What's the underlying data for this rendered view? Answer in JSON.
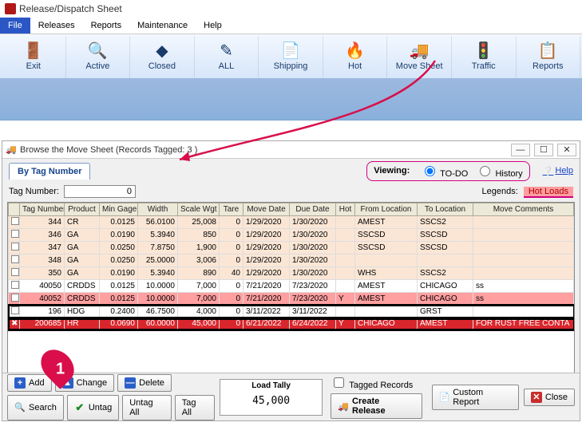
{
  "app": {
    "title": "Release/Dispatch Sheet"
  },
  "menubar": [
    "File",
    "Releases",
    "Reports",
    "Maintenance",
    "Help"
  ],
  "toolbar": [
    {
      "label": "Exit",
      "icon": "🚪"
    },
    {
      "label": "Active",
      "icon": "🔍"
    },
    {
      "label": "Closed",
      "icon": "◆"
    },
    {
      "label": "ALL",
      "icon": "✎"
    },
    {
      "label": "Shipping",
      "icon": "📄"
    },
    {
      "label": "Hot",
      "icon": "🔥"
    },
    {
      "label": "Move Sheet",
      "icon": "🚚"
    },
    {
      "label": "Traffic",
      "icon": "🚦"
    },
    {
      "label": "Reports",
      "icon": "📋"
    }
  ],
  "child": {
    "title": "Browse the Move Sheet  (Records Tagged:  3 )",
    "tab": "By Tag Number",
    "viewing_label": "Viewing:",
    "viewing_opts": [
      "TO-DO",
      "History"
    ],
    "help": "Help",
    "tagnum_label": "Tag Number:",
    "tagnum_value": "0",
    "legends_label": "Legends:",
    "legends_hot": "Hot Loads"
  },
  "grid": {
    "headers": [
      "",
      "Tag Number",
      "Product",
      "Min Gage",
      "Width",
      "Scale Wgt",
      "Tare",
      "Move Date",
      "Due Date",
      "Hot",
      "From Location",
      "To Location",
      "Move Comments"
    ],
    "rows": [
      {
        "ck": "",
        "tag": "344",
        "prod": "CR",
        "gage": "0.0125",
        "width": "56.0100",
        "wgt": "25,008",
        "tare": "0",
        "md": "1/29/2020",
        "dd": "1/30/2020",
        "hot": "",
        "from": "AMEST",
        "to": "SSCS2",
        "cm": "",
        "cls": ""
      },
      {
        "ck": "",
        "tag": "346",
        "prod": "GA",
        "gage": "0.0190",
        "width": "5.3940",
        "wgt": "850",
        "tare": "0",
        "md": "1/29/2020",
        "dd": "1/30/2020",
        "hot": "",
        "from": "SSCSD",
        "to": "SSCSD",
        "cm": "",
        "cls": ""
      },
      {
        "ck": "",
        "tag": "347",
        "prod": "GA",
        "gage": "0.0250",
        "width": "7.8750",
        "wgt": "1,900",
        "tare": "0",
        "md": "1/29/2020",
        "dd": "1/30/2020",
        "hot": "",
        "from": "SSCSD",
        "to": "SSCSD",
        "cm": "",
        "cls": ""
      },
      {
        "ck": "",
        "tag": "348",
        "prod": "GA",
        "gage": "0.0250",
        "width": "25.0000",
        "wgt": "3,006",
        "tare": "0",
        "md": "1/29/2020",
        "dd": "1/30/2020",
        "hot": "",
        "from": "",
        "to": "",
        "cm": "",
        "cls": ""
      },
      {
        "ck": "",
        "tag": "350",
        "prod": "GA",
        "gage": "0.0190",
        "width": "5.3940",
        "wgt": "890",
        "tare": "40",
        "md": "1/29/2020",
        "dd": "1/30/2020",
        "hot": "",
        "from": "WHS",
        "to": "SSCS2",
        "cm": "",
        "cls": ""
      },
      {
        "ck": "",
        "tag": "40050",
        "prod": "CRDDS",
        "gage": "0.0125",
        "width": "10.0000",
        "wgt": "7,000",
        "tare": "0",
        "md": "7/21/2020",
        "dd": "7/23/2020",
        "hot": "",
        "from": "AMEST",
        "to": "CHICAGO",
        "cm": "ss",
        "cls": "plain"
      },
      {
        "ck": "",
        "tag": "40052",
        "prod": "CRDDS",
        "gage": "0.0125",
        "width": "10.0000",
        "wgt": "7,000",
        "tare": "0",
        "md": "7/21/2020",
        "dd": "7/23/2020",
        "hot": "Y",
        "from": "AMEST",
        "to": "CHICAGO",
        "cm": "ss",
        "cls": "hot"
      },
      {
        "ck": "",
        "tag": "196",
        "prod": "HDG",
        "gage": "0.2400",
        "width": "46.7500",
        "wgt": "4,000",
        "tare": "0",
        "md": "3/11/2022",
        "dd": "3/11/2022",
        "hot": "",
        "from": "",
        "to": "GRST",
        "cm": "",
        "cls": "plain boxed"
      },
      {
        "ck": "✖",
        "tag": "200685",
        "prod": "HR",
        "gage": "0.0690",
        "width": "60.0000",
        "wgt": "45,000",
        "tare": "0",
        "md": "6/21/2022",
        "dd": "6/24/2022",
        "hot": "Y",
        "from": "CHICAGO",
        "to": "AMEST",
        "cm": "FOR RUST FREE CONTA",
        "cls": "sel boxed"
      }
    ]
  },
  "tally": {
    "label": "Load Tally",
    "value": "45,000"
  },
  "buttons": {
    "add": "Add",
    "change": "Change",
    "delete": "Delete",
    "search": "Search",
    "untag": "Untag",
    "untag_all": "Untag All",
    "tag_all": "Tag All",
    "tagged_records": "Tagged Records",
    "create_release": "Create Release",
    "custom_report": "Custom Report",
    "close": "Close"
  },
  "callout": "1"
}
